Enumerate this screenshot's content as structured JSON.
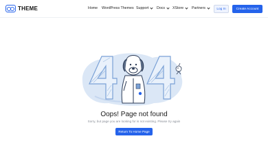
{
  "brand": {
    "name": "THEME",
    "accent": "#2563eb"
  },
  "nav": {
    "items": [
      {
        "label": "Home",
        "dropdown": false
      },
      {
        "label": "WordPress Themes",
        "dropdown": false
      },
      {
        "label": "Support",
        "dropdown": true
      },
      {
        "label": "Docs",
        "dropdown": true
      },
      {
        "label": "XStore",
        "dropdown": true
      },
      {
        "label": "Partners",
        "dropdown": true
      }
    ]
  },
  "header": {
    "login_label": "Log In",
    "create_label": "Create Account"
  },
  "error": {
    "title": "Oops! Page not found",
    "message": "Sorry, but page you are looking for is not existing. Please try again",
    "button_label": "Return To Home Page"
  }
}
